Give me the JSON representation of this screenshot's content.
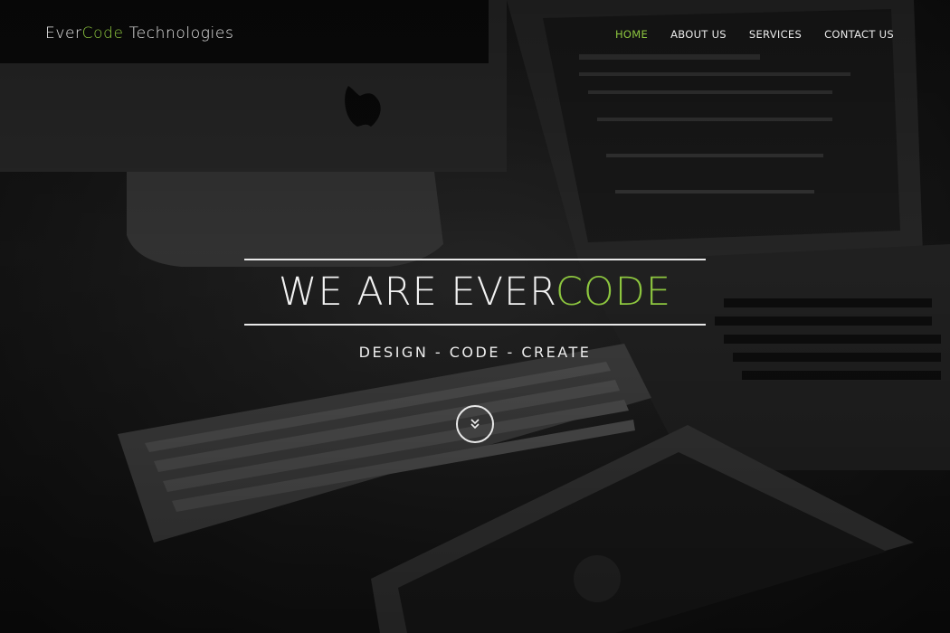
{
  "brand": {
    "part1": "Ever",
    "part2": "Code",
    "part3": " Technologies"
  },
  "nav": {
    "items": [
      {
        "label": "HOME",
        "active": true
      },
      {
        "label": "ABOUT US",
        "active": false
      },
      {
        "label": "SERVICES",
        "active": false
      },
      {
        "label": "CONTACT US",
        "active": false
      }
    ]
  },
  "hero": {
    "headline_part1": "WE ARE EVER",
    "headline_part2": "CODE",
    "tagline": "DESIGN - CODE - CREATE",
    "scroll_icon": "chevron-double-down-icon"
  },
  "colors": {
    "accent": "#8dc63f",
    "text": "#ffffff",
    "background": "#121212"
  }
}
